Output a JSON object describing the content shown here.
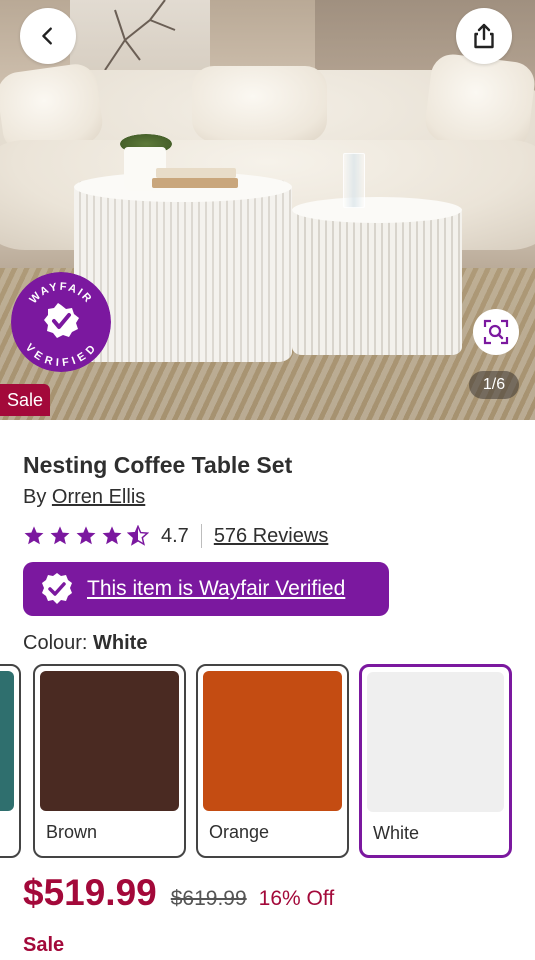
{
  "gallery": {
    "counter": "1/6",
    "sale_tag": "Sale",
    "badge_text_top": "WAYFAIR",
    "badge_text_bottom": "VERIFIED"
  },
  "product": {
    "title": "Nesting Coffee Table Set",
    "by_prefix": "By ",
    "brand": "Orren Ellis",
    "rating": "4.7",
    "rating_value": 4.7,
    "rating_max": 5,
    "reviews": "576 Reviews",
    "verified_text": "This item is Wayfair Verified"
  },
  "colour": {
    "label": "Colour: ",
    "selected": "White",
    "options": [
      {
        "name": "Teal",
        "hex": "#2f6f6e"
      },
      {
        "name": "Brown",
        "hex": "#4a2a22"
      },
      {
        "name": "Orange",
        "hex": "#c44c12"
      },
      {
        "name": "White",
        "hex": "#efefef"
      }
    ]
  },
  "pricing": {
    "price": "$519.99",
    "old_price": "$619.99",
    "discount": "16% Off",
    "sale_label": "Sale"
  },
  "colors": {
    "brand_purple": "#7b189f",
    "sale_red": "#a3093a"
  },
  "icons": {
    "back": "chevron-left-icon",
    "share": "share-icon",
    "zoom": "visual-search-icon",
    "verified": "check-badge-icon",
    "star": "star-icon"
  }
}
